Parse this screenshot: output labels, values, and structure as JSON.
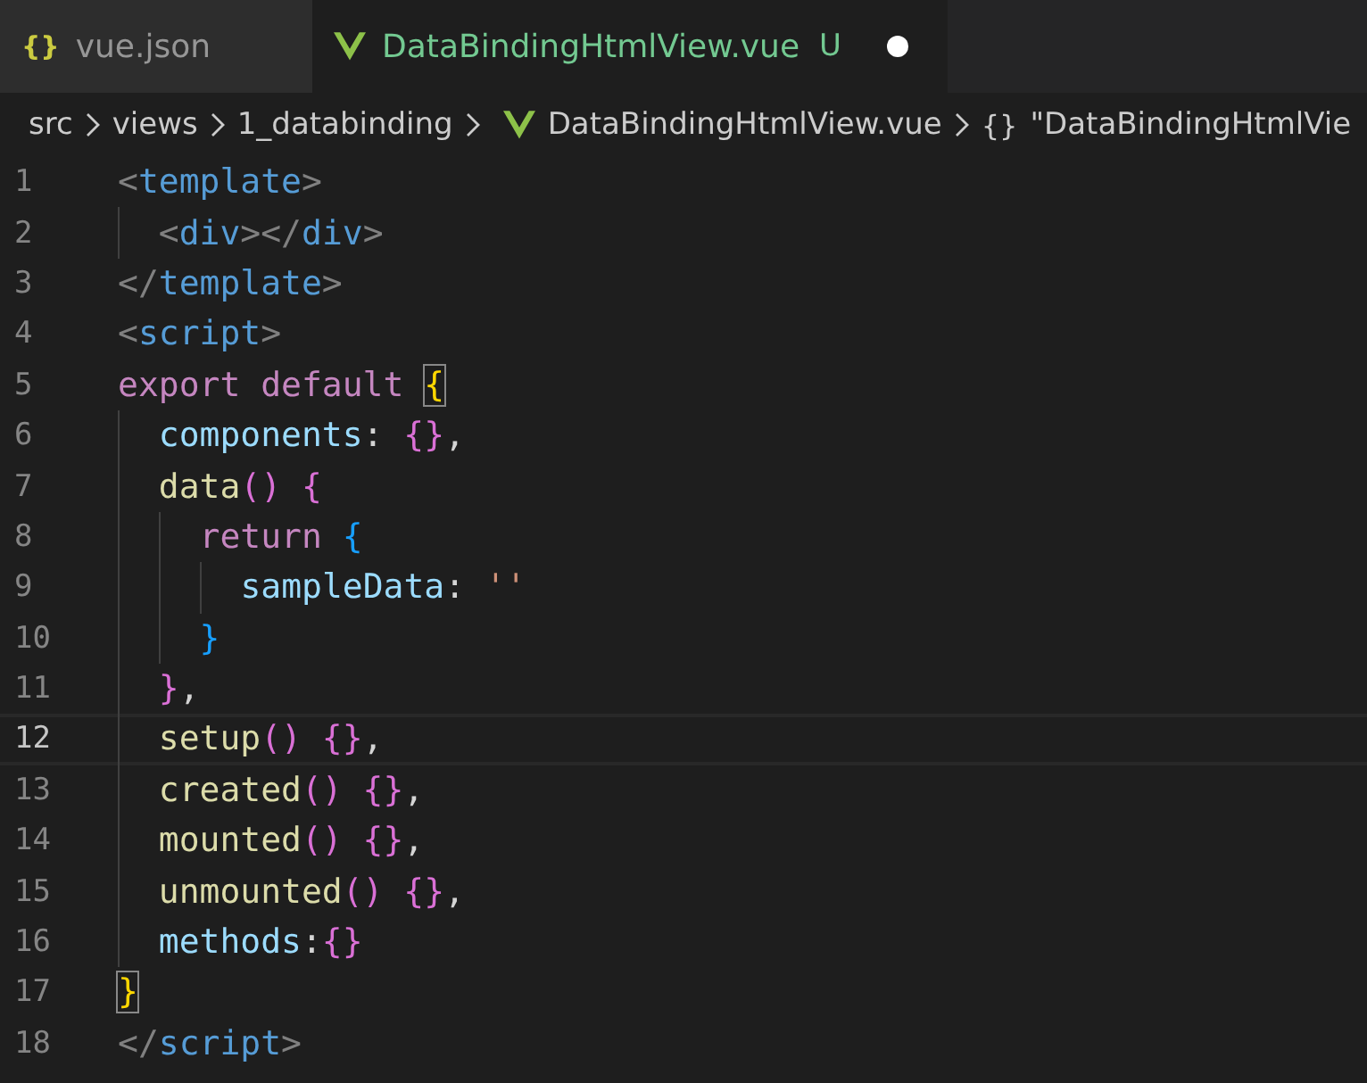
{
  "tabs": [
    {
      "label": "vue.json",
      "icon_text": "{}",
      "kind": "json",
      "selected": false,
      "modified": false
    },
    {
      "label": "DataBindingHtmlView.vue",
      "kind": "vue",
      "badge": "U",
      "selected": true,
      "modified": true
    }
  ],
  "breadcrumb": [
    {
      "label": "src",
      "kind": "folder"
    },
    {
      "label": "views",
      "kind": "folder"
    },
    {
      "label": "1_databinding",
      "kind": "folder"
    },
    {
      "label": "DataBindingHtmlView.vue",
      "kind": "vue"
    },
    {
      "label": "\"DataBindingHtmlVie",
      "icon_text": "{}",
      "kind": "symbol"
    }
  ],
  "lines": [
    {
      "number": "1",
      "current": false,
      "tokens": [
        {
          "t": "<",
          "color": "#808080"
        },
        {
          "t": "template",
          "color": "#569cd6"
        },
        {
          "t": ">",
          "color": "#808080"
        }
      ],
      "children": [
        {
          "number": "2",
          "current": false,
          "tokens": [
            {
              "t": "<",
              "color": "#808080"
            },
            {
              "t": "div",
              "color": "#569cd6"
            },
            {
              "t": "></",
              "color": "#808080"
            },
            {
              "t": "div",
              "color": "#569cd6"
            },
            {
              "t": ">",
              "color": "#808080"
            }
          ]
        }
      ]
    },
    {
      "number": "3",
      "current": false,
      "tokens": [
        {
          "t": "</",
          "color": "#808080"
        },
        {
          "t": "template",
          "color": "#569cd6"
        },
        {
          "t": ">",
          "color": "#808080"
        }
      ]
    },
    {
      "number": "4",
      "current": false,
      "tokens": [
        {
          "t": "<",
          "color": "#808080"
        },
        {
          "t": "script",
          "color": "#569cd6"
        },
        {
          "t": ">",
          "color": "#808080"
        }
      ]
    },
    {
      "number": "5",
      "current": false,
      "tokens": [
        {
          "t": "export default ",
          "color": "#c586c0"
        },
        {
          "t": "{",
          "color": "#ffd700",
          "matched": true
        }
      ],
      "children": [
        {
          "number": "6",
          "current": false,
          "tokens": [
            {
              "t": "components",
              "color": "#9cdcfe"
            },
            {
              "t": ": ",
              "color": "#d4d4d4"
            },
            {
              "t": "{}",
              "color": "#da70d6"
            },
            {
              "t": ",",
              "color": "#d4d4d4"
            }
          ]
        },
        {
          "number": "7",
          "current": false,
          "tokens": [
            {
              "t": "data",
              "color": "#dcdcaa"
            },
            {
              "t": "() {",
              "color": "#da70d6"
            }
          ],
          "children": [
            {
              "number": "8",
              "current": false,
              "tokens": [
                {
                  "t": "return ",
                  "color": "#c586c0"
                },
                {
                  "t": "{",
                  "color": "#179fff"
                }
              ],
              "children": [
                {
                  "number": "9",
                  "current": false,
                  "tokens": [
                    {
                      "t": "sampleData",
                      "color": "#9cdcfe"
                    },
                    {
                      "t": ": ",
                      "color": "#d4d4d4"
                    },
                    {
                      "t": "''",
                      "color": "#ce9178"
                    }
                  ]
                }
              ]
            },
            {
              "number": "10",
              "current": false,
              "tokens": [
                {
                  "t": "}",
                  "color": "#179fff"
                }
              ]
            }
          ]
        },
        {
          "number": "11",
          "current": false,
          "tokens": [
            {
              "t": "}",
              "color": "#da70d6"
            },
            {
              "t": ",",
              "color": "#d4d4d4"
            }
          ]
        },
        {
          "number": "12",
          "current": true,
          "tokens": [
            {
              "t": "setup",
              "color": "#dcdcaa"
            },
            {
              "t": "() {}",
              "color": "#da70d6"
            },
            {
              "t": ",",
              "color": "#d4d4d4"
            }
          ]
        },
        {
          "number": "13",
          "current": false,
          "tokens": [
            {
              "t": "created",
              "color": "#dcdcaa"
            },
            {
              "t": "() {}",
              "color": "#da70d6"
            },
            {
              "t": ",",
              "color": "#d4d4d4"
            }
          ]
        },
        {
          "number": "14",
          "current": false,
          "tokens": [
            {
              "t": "mounted",
              "color": "#dcdcaa"
            },
            {
              "t": "() {}",
              "color": "#da70d6"
            },
            {
              "t": ",",
              "color": "#d4d4d4"
            }
          ]
        },
        {
          "number": "15",
          "current": false,
          "tokens": [
            {
              "t": "unmounted",
              "color": "#dcdcaa"
            },
            {
              "t": "() {}",
              "color": "#da70d6"
            },
            {
              "t": ",",
              "color": "#d4d4d4"
            }
          ]
        },
        {
          "number": "16",
          "current": false,
          "tokens": [
            {
              "t": "methods",
              "color": "#9cdcfe"
            },
            {
              "t": ":",
              "color": "#d4d4d4"
            },
            {
              "t": "{}",
              "color": "#da70d6"
            }
          ]
        }
      ]
    },
    {
      "number": "17",
      "current": false,
      "tokens": [
        {
          "t": "}",
          "color": "#ffd700",
          "matched": true
        }
      ]
    },
    {
      "number": "18",
      "current": false,
      "tokens": [
        {
          "t": "</",
          "color": "#808080"
        },
        {
          "t": "script",
          "color": "#569cd6"
        },
        {
          "t": ">",
          "color": "#808080"
        }
      ]
    }
  ]
}
